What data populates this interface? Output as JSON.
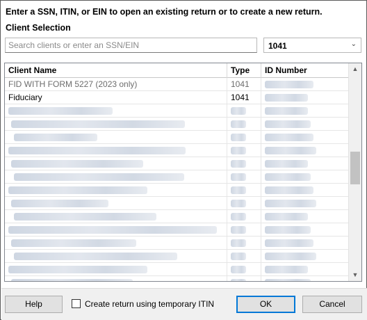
{
  "instruction": "Enter a SSN, ITIN, or EIN to open an existing return or to create a new return.",
  "client_selection_label": "Client Selection",
  "search": {
    "placeholder": "Search clients or enter an SSN/EIN",
    "value": ""
  },
  "return_type": {
    "selected": "1041"
  },
  "table": {
    "columns": [
      "Client Name",
      "Type",
      "ID Number"
    ],
    "rows": [
      {
        "name": "FID WITH FORM 5227 (2023 only)",
        "type": "1041",
        "id": "",
        "dim": true
      },
      {
        "name": "Fiduciary",
        "type": "1041",
        "id": "",
        "dim": false
      }
    ]
  },
  "footer": {
    "help_label": "Help",
    "temp_itin_label": "Create return using temporary ITIN",
    "temp_itin_checked": false,
    "ok_label": "OK",
    "cancel_label": "Cancel"
  },
  "colors": {
    "accent": "#0078d7",
    "dim_text": "#6d6d6d"
  },
  "icons": {
    "dropdown": "chevron-down-icon",
    "scroll_up": "scroll-up-arrow-icon",
    "scroll_down": "scroll-down-arrow-icon"
  }
}
